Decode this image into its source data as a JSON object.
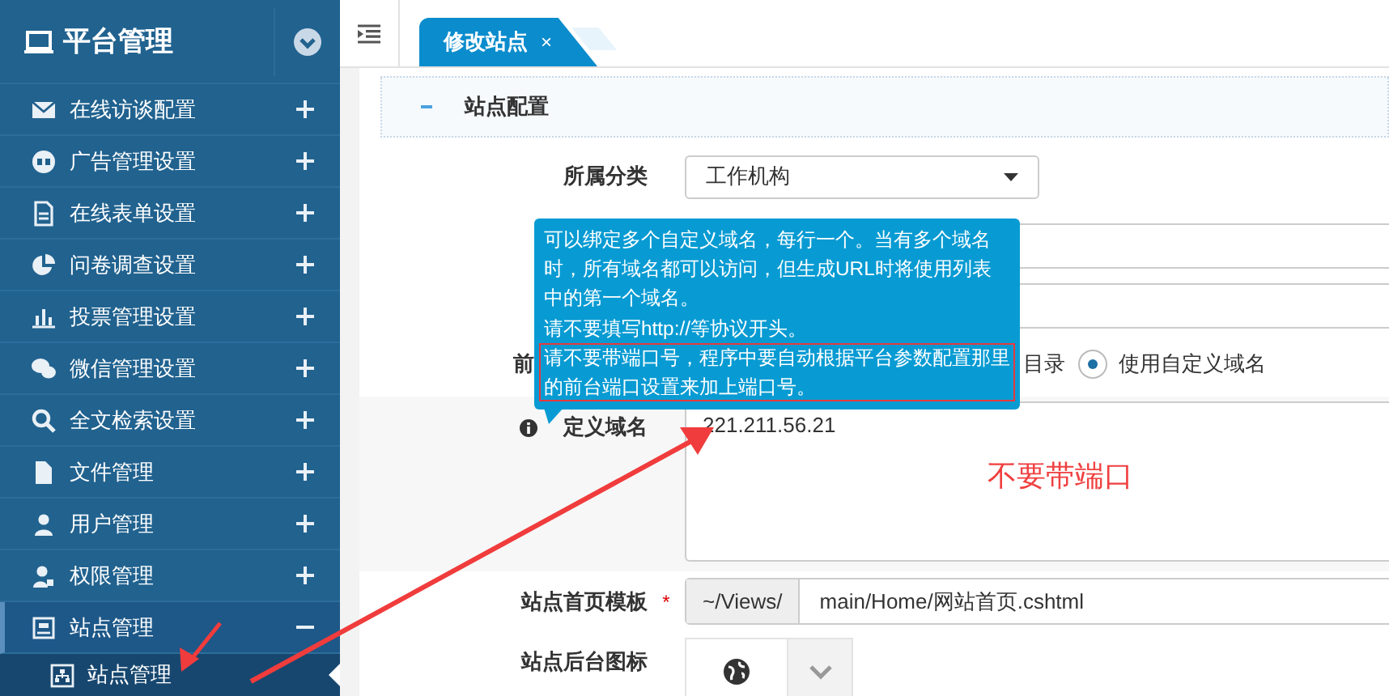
{
  "sidebar": {
    "title": "平台管理",
    "items": [
      {
        "label": "在线访谈配置",
        "expanded": false
      },
      {
        "label": "广告管理设置",
        "expanded": false
      },
      {
        "label": "在线表单设置",
        "expanded": false
      },
      {
        "label": "问卷调查设置",
        "expanded": false
      },
      {
        "label": "投票管理设置",
        "expanded": false
      },
      {
        "label": "微信管理设置",
        "expanded": false
      },
      {
        "label": "全文检索设置",
        "expanded": false
      },
      {
        "label": "文件管理",
        "expanded": false
      },
      {
        "label": "用户管理",
        "expanded": false
      },
      {
        "label": "权限管理",
        "expanded": false
      },
      {
        "label": "站点管理",
        "expanded": true,
        "children": [
          {
            "label": "站点管理",
            "selected": true
          }
        ]
      }
    ]
  },
  "tabs": [
    {
      "label": "修改站点",
      "close": "×",
      "selected": true
    },
    {
      "selected": false
    }
  ],
  "section": {
    "title": "站点配置",
    "expanded": true
  },
  "form": {
    "rows": [
      {
        "kind": "select",
        "label": "所属分类",
        "value": "工作机构"
      },
      {
        "kind": "input"
      },
      {
        "kind": "input"
      },
      {
        "kind": "radio",
        "label": "前",
        "options": [
          {
            "label": "目录"
          },
          {
            "label": "使用自定义域名",
            "selected": true
          }
        ]
      },
      {
        "kind": "textarea",
        "label": "定义域名",
        "info": true,
        "value": "221.211.56.21"
      },
      {
        "kind": "addon",
        "label": "站点首页模板",
        "required_mark": "*",
        "addon": "~/Views/",
        "value": "main/Home/网站首页.cshtml"
      },
      {
        "kind": "iconpicker",
        "label": "站点后台图标"
      }
    ]
  },
  "tooltip": {
    "paragraphs": [
      {
        "text": "可以绑定多个自定义域名，每行一个。当有多个域名时，所有域名都可以访问，但生成URL时将使用列表中的第一个域名。",
        "highlighted": false
      },
      {
        "text": "请不要填写http://等协议开头。",
        "highlighted": false
      },
      {
        "text": "请不要带端口号，程序中要自动根据平台参数配置那里的前台端口设置来加上端口号。",
        "highlighted": true
      }
    ]
  },
  "annotation": {
    "note": "不要带端口"
  }
}
